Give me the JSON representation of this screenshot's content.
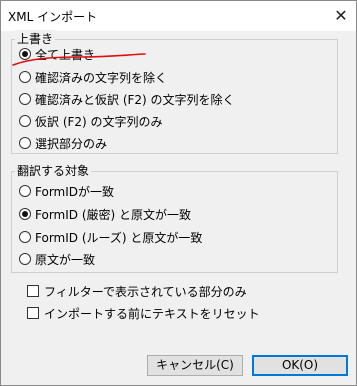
{
  "window": {
    "title": "XML インポート",
    "close_glyph": "✕"
  },
  "overwrite_group": {
    "label": "上書き",
    "options": [
      {
        "label": "全て上書き",
        "selected": true
      },
      {
        "label": "確認済みの文字列を除く",
        "selected": false
      },
      {
        "label": "確認済みと仮訳 (F2) の文字列を除く",
        "selected": false
      },
      {
        "label": "仮訳 (F2) の文字列のみ",
        "selected": false
      },
      {
        "label": "選択部分のみ",
        "selected": false
      }
    ]
  },
  "target_group": {
    "label": "翻訳する対象",
    "options": [
      {
        "label": "FormIDが一致",
        "selected": false
      },
      {
        "label": "FormID (厳密) と原文が一致",
        "selected": true
      },
      {
        "label": "FormID (ルーズ) と原文が一致",
        "selected": false
      },
      {
        "label": "原文が一致",
        "selected": false
      }
    ]
  },
  "checkboxes": [
    {
      "label": "フィルターで表示されている部分のみ",
      "checked": false
    },
    {
      "label": "インポートする前にテキストをリセット",
      "checked": false
    }
  ],
  "buttons": {
    "cancel": "キャンセル(C)",
    "ok": "OK(O)"
  },
  "colors": {
    "annotation_stroke": "#e01010",
    "default_button_border": "#0078d7"
  }
}
